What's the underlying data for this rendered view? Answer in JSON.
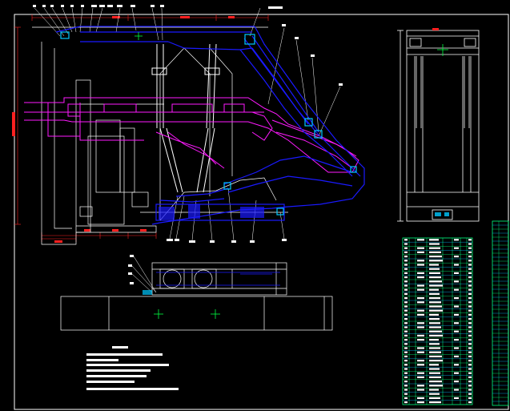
{
  "colors": {
    "background": "#000000",
    "frame": "#ffffff",
    "support_main": "#1a1aff",
    "support_alt": "#ff1aff",
    "outline": "#ffffff",
    "dimension": "#ff2020",
    "hydraulics": "#ffffff",
    "center_mark": "#00ff40",
    "highlight": "#00c8ff",
    "table_line": "#00ff80",
    "table_line_alt": "#00c0ff",
    "notes_fill": "#ffffff"
  },
  "icons": {
    "pin_joint": "square-pin-icon",
    "center_mark": "crosshair-icon"
  }
}
